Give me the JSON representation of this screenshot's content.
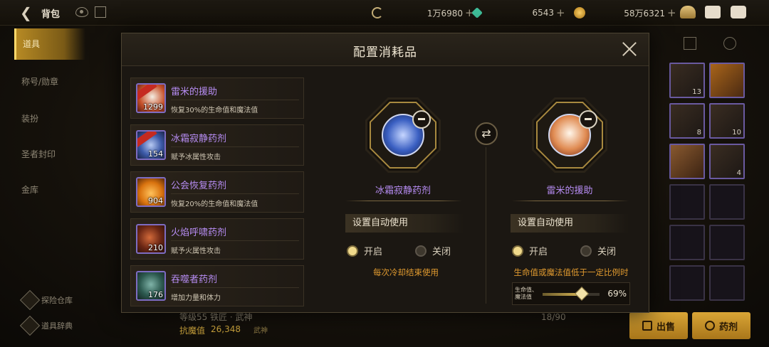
{
  "topbar": {
    "title": "背包",
    "currencies": [
      {
        "name": "moon-currency-icon",
        "value": "1万6980",
        "color": "#c9b27a"
      },
      {
        "name": "gem-currency-icon",
        "value": "6543",
        "color": "#3fbf9a"
      },
      {
        "name": "gold-currency-icon",
        "value": "58万6321",
        "color": "#e0ac35"
      }
    ],
    "plus": "+"
  },
  "left_nav": {
    "items": [
      "道具",
      "称号/勋章",
      "装扮",
      "圣者封印",
      "金库"
    ],
    "bottom_items": [
      "探险仓库",
      "道具辞典"
    ]
  },
  "background_info": {
    "level_text": "等级55 铁匠 · 武神",
    "power_label": "抗魔值",
    "power_value": "26,348",
    "class_label": "武神",
    "capacity": "18/90",
    "sell_button": "出售",
    "potion_button": "药剂"
  },
  "modal": {
    "title": "配置消耗品",
    "items": [
      {
        "name": "雷米的援助",
        "desc": "恢复30%的生命值和魔法值",
        "qty": "1299",
        "ribbon": true,
        "color": "#e9dccb"
      },
      {
        "name": "冰霜寂静药剂",
        "desc": "赋予冰属性攻击",
        "qty": "154",
        "ribbon": true,
        "color": "#4d75c9"
      },
      {
        "name": "公会恢复药剂",
        "desc": "恢复20%的生命值和魔法值",
        "qty": "904",
        "ribbon": false,
        "color": "#e08a1c"
      },
      {
        "name": "火焰呼啸药剂",
        "desc": "赋予火属性攻击",
        "qty": "210",
        "ribbon": false,
        "color": "#8a3a22"
      },
      {
        "name": "吞噬者药剂",
        "desc": "增加力量和体力",
        "qty": "176",
        "ribbon": false,
        "color": "#3b6a5f"
      }
    ],
    "slot_left": {
      "name": "冰霜寂静药剂",
      "auto_header": "设置自动使用",
      "on_label": "开启",
      "off_label": "关闭",
      "on_selected": true,
      "note": "每次冷却结束使用"
    },
    "slot_right": {
      "name": "雷米的援助",
      "auto_header": "设置自动使用",
      "on_label": "开启",
      "off_label": "关闭",
      "on_selected": true,
      "note": "生命值或魔法值低于一定比例时",
      "threshold_label": "生命值、魔法值",
      "threshold_pct": "69%",
      "threshold_fraction": 0.69
    }
  }
}
